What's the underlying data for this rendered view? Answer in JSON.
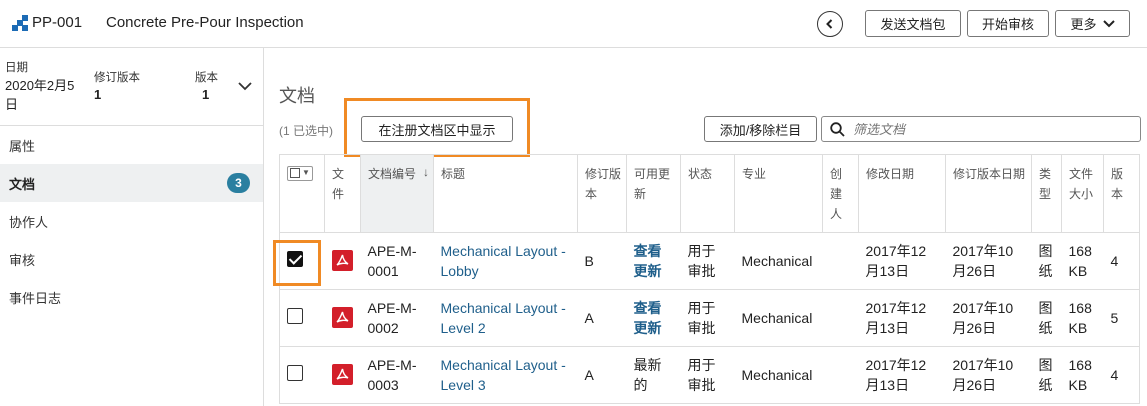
{
  "header": {
    "id": "PP-001",
    "title": "Concrete Pre-Pour Inspection",
    "buttons": {
      "send": "发送文档包",
      "start_review": "开始审核",
      "more": "更多"
    }
  },
  "sidebar": {
    "meta": {
      "date_label": "日期",
      "date_value": "2020年2月5日",
      "revision_label": "修订版本",
      "revision_value": "1",
      "version_label": "版本",
      "version_value": "1"
    },
    "items": [
      {
        "label": "属性"
      },
      {
        "label": "文档",
        "badge": "3"
      },
      {
        "label": "协作人"
      },
      {
        "label": "审核"
      },
      {
        "label": "事件日志"
      }
    ]
  },
  "main": {
    "title": "文档",
    "selected_count": "(1 已选中)",
    "show_in_register_button": "在注册文档区中显示",
    "add_remove_columns_button": "添加/移除栏目",
    "filter_placeholder": "筛选文档"
  },
  "table": {
    "columns": [
      "文件",
      "文档编号",
      "标题",
      "修订版本",
      "可用更新",
      "状态",
      "专业",
      "创建人",
      "修改日期",
      "修订版本日期",
      "类型",
      "文件大小",
      "版本"
    ],
    "rows": [
      {
        "checked": true,
        "doc_no": "APE-M-0001",
        "title": "Mechanical Layout - Lobby",
        "revision": "B",
        "update": "查看更新",
        "status": "用于审批",
        "discipline": "Mechanical",
        "creator": "",
        "modified": "2017年12月13日",
        "rev_date": "2017年10月26日",
        "type": "图纸",
        "size": "168 KB",
        "version": "4"
      },
      {
        "checked": false,
        "doc_no": "APE-M-0002",
        "title": "Mechanical Layout - Level 2",
        "revision": "A",
        "update": "查看更新",
        "status": "用于审批",
        "discipline": "Mechanical",
        "creator": "",
        "modified": "2017年12月13日",
        "rev_date": "2017年10月26日",
        "type": "图纸",
        "size": "168 KB",
        "version": "5"
      },
      {
        "checked": false,
        "doc_no": "APE-M-0003",
        "title": "Mechanical Layout - Level 3",
        "revision": "A",
        "update": "最新的",
        "status": "用于审批",
        "discipline": "Mechanical",
        "creator": "",
        "modified": "2017年12月13日",
        "rev_date": "2017年10月26日",
        "type": "图纸",
        "size": "168 KB",
        "version": "4"
      }
    ]
  },
  "colors": {
    "accent": "#1c6bb5",
    "highlight": "#f08a24",
    "badge": "#2a7fa0",
    "pdf": "#d31f2a",
    "link": "#1f5f8b"
  },
  "icons": [
    "logo-icon",
    "back-icon",
    "chevron-down-icon",
    "search-icon",
    "pdf-icon",
    "sort-down-icon"
  ]
}
